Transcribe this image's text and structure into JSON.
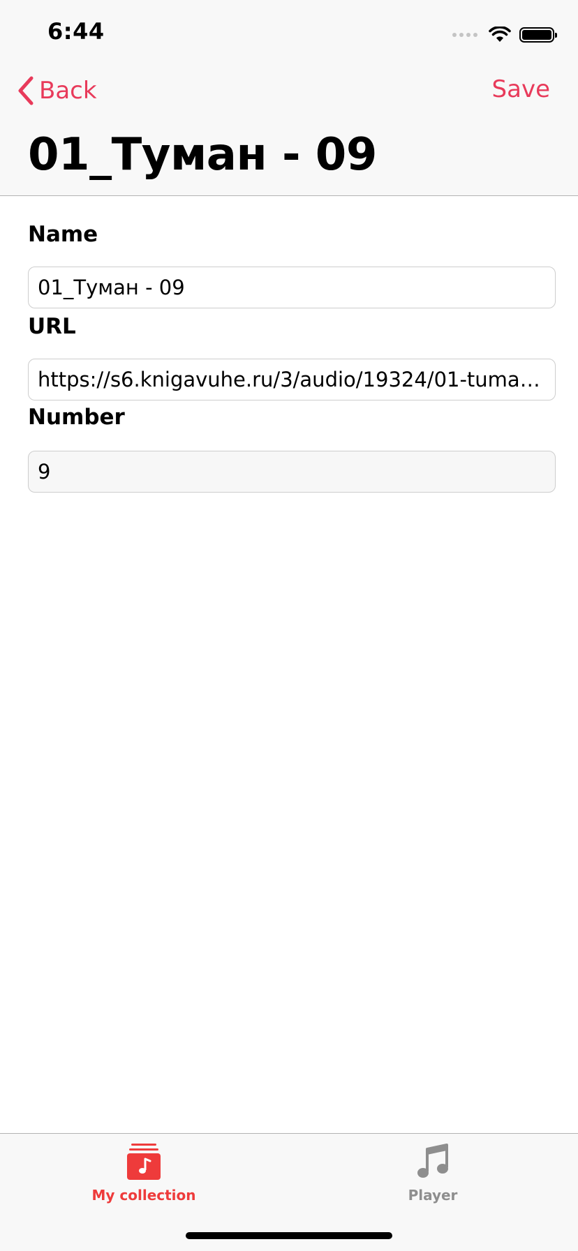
{
  "status_bar": {
    "time": "6:44"
  },
  "nav": {
    "back_label": "Back",
    "save_label": "Save",
    "title": "01_Туман - 09"
  },
  "form": {
    "fields": [
      {
        "label": "Name",
        "value": "01_Туман - 09",
        "editable": true
      },
      {
        "label": "URL",
        "value": "https://s6.knigavuhe.ru/3/audio/19324/01-tuman...",
        "editable": true
      },
      {
        "label": "Number",
        "value": "9",
        "editable": false
      }
    ]
  },
  "tab_bar": {
    "items": [
      {
        "label": "My collection",
        "icon": "music-collection-icon",
        "selected": true
      },
      {
        "label": "Player",
        "icon": "music-note-icon",
        "selected": false
      }
    ]
  },
  "colors": {
    "accent": "#e83a5a",
    "tab_selected": "#ee3b3b",
    "tab_unselected": "#8e8e8e"
  }
}
